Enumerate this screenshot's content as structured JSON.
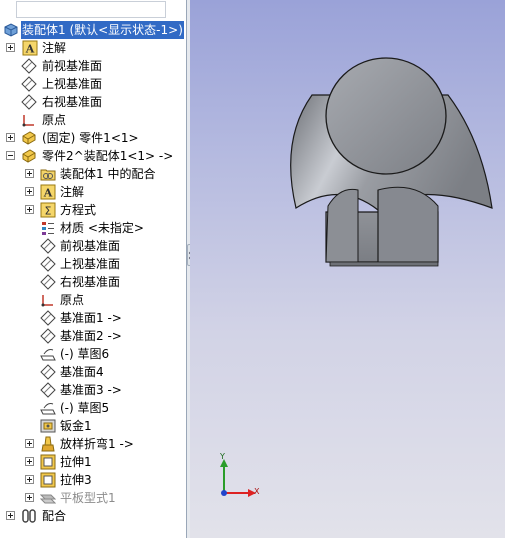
{
  "tree": {
    "root_label": "装配体1 (默认<显示状态-1>)",
    "items": [
      {
        "label": "注解",
        "icon": "annotation-icon"
      },
      {
        "label": "前视基准面",
        "icon": "plane-icon"
      },
      {
        "label": "上视基准面",
        "icon": "plane-icon"
      },
      {
        "label": "右视基准面",
        "icon": "plane-icon"
      },
      {
        "label": "原点",
        "icon": "origin-icon"
      },
      {
        "label": "(固定) 零件1<1>",
        "icon": "part-icon"
      },
      {
        "label": "零件2^装配体1<1> ->",
        "icon": "part-icon"
      },
      {
        "label": "装配体1 中的配合",
        "icon": "mates-folder-icon"
      },
      {
        "label": "注解",
        "icon": "annotation-icon"
      },
      {
        "label": "方程式",
        "icon": "equation-icon"
      },
      {
        "label": "材质 <未指定>",
        "icon": "material-icon"
      },
      {
        "label": "前视基准面",
        "icon": "plane-icon"
      },
      {
        "label": "上视基准面",
        "icon": "plane-icon"
      },
      {
        "label": "右视基准面",
        "icon": "plane-icon"
      },
      {
        "label": "原点",
        "icon": "origin-icon"
      },
      {
        "label": "基准面1 ->",
        "icon": "plane-icon"
      },
      {
        "label": "基准面2 ->",
        "icon": "plane-icon"
      },
      {
        "label": "(-) 草图6",
        "icon": "sketch-icon"
      },
      {
        "label": "基准面4",
        "icon": "plane-icon"
      },
      {
        "label": "基准面3 ->",
        "icon": "plane-icon"
      },
      {
        "label": "(-) 草图5",
        "icon": "sketch-icon"
      },
      {
        "label": "钣金1",
        "icon": "sheetmetal-icon"
      },
      {
        "label": "放样折弯1 ->",
        "icon": "lofted-bend-icon"
      },
      {
        "label": "拉伸1",
        "icon": "extrude-icon"
      },
      {
        "label": "拉伸3",
        "icon": "extrude-icon"
      },
      {
        "label": "平板型式1",
        "icon": "flat-pattern-icon"
      },
      {
        "label": "配合",
        "icon": "mates-icon"
      }
    ]
  },
  "triad": {
    "y_label": "Y",
    "x_label": "X"
  },
  "colors": {
    "selection": "#316ac5",
    "viewport_top": "#9aa2d8",
    "viewport_bottom": "#e2e2ea",
    "model_gray": "#8a8d92"
  }
}
